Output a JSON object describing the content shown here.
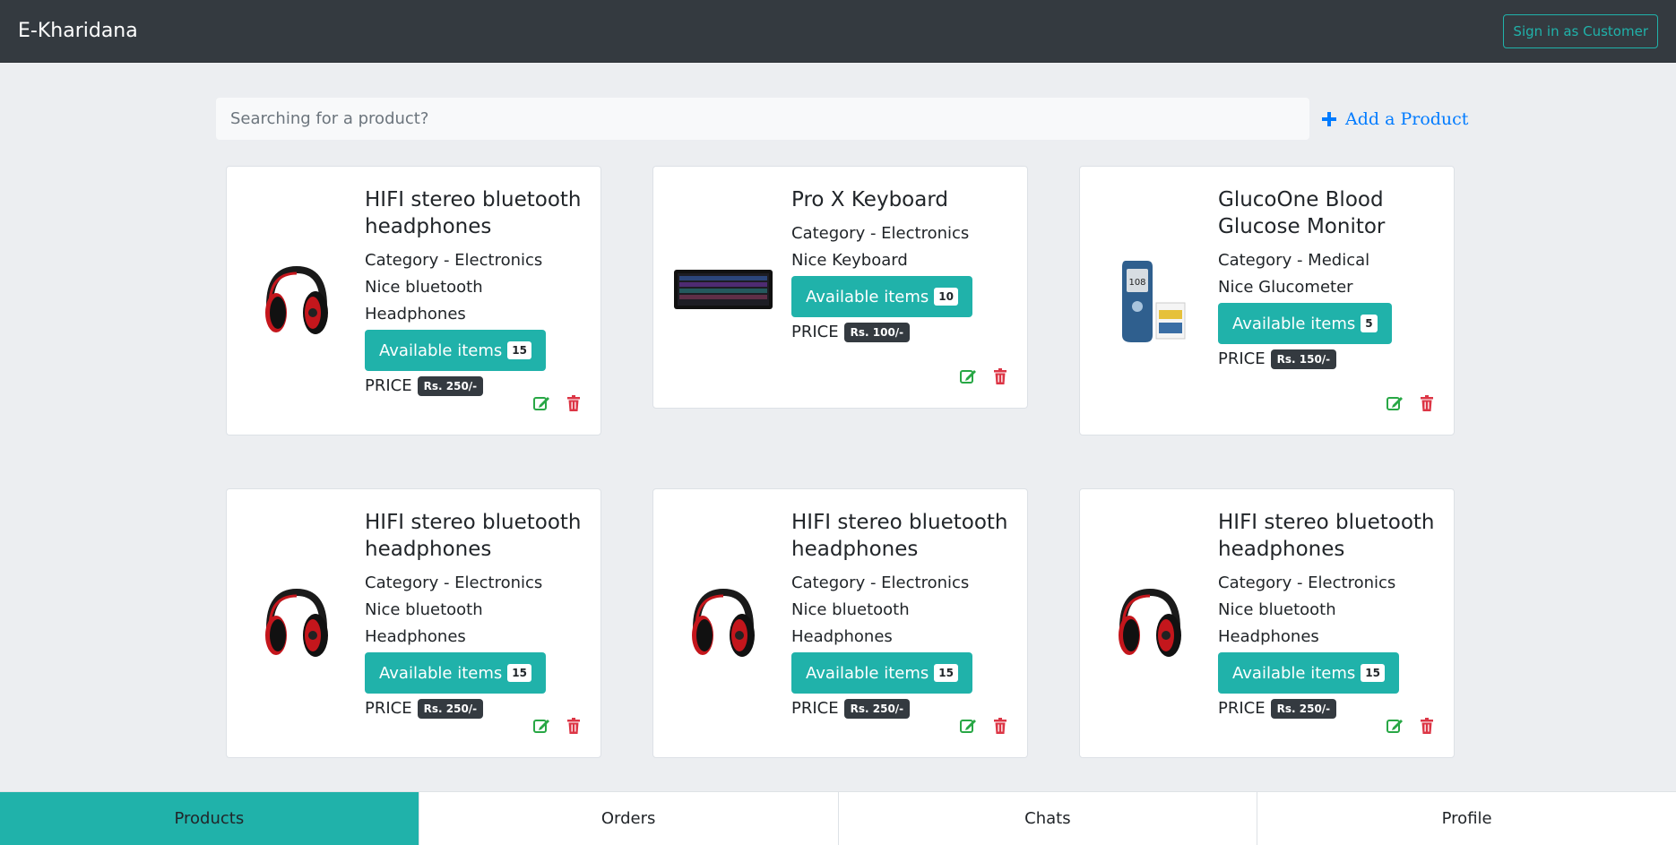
{
  "navbar": {
    "brand": "E-Kharidana",
    "signin_label": "Sign in as Customer"
  },
  "search": {
    "placeholder": "Searching for a product?",
    "add_product_label": "Add a Product"
  },
  "colors": {
    "accent": "#20b2aa",
    "navbar_bg": "#343a40",
    "edit_icon": "#28a745",
    "delete_icon": "#dc3545",
    "link": "#007bff"
  },
  "products": [
    {
      "title": "HIFI stereo bluetooth headphones",
      "category": "Category - Electronics",
      "description": "Nice bluetooth Headphones",
      "available_label": "Available items",
      "available_count": "15",
      "price_label": "PRICE",
      "price": "Rs. 250/-",
      "image": "headphones-image"
    },
    {
      "title": "Pro X Keyboard",
      "category": "Category - Electronics",
      "description": "Nice Keyboard",
      "available_label": "Available items",
      "available_count": "10",
      "price_label": "PRICE",
      "price": "Rs. 100/-",
      "image": "keyboard-image"
    },
    {
      "title": "GlucoOne Blood Glucose Monitor",
      "category": "Category - Medical",
      "description": "Nice Glucometer",
      "available_label": "Available items",
      "available_count": "5",
      "price_label": "PRICE",
      "price": "Rs. 150/-",
      "image": "glucometer-image"
    },
    {
      "title": "HIFI stereo bluetooth headphones",
      "category": "Category - Electronics",
      "description": "Nice bluetooth Headphones",
      "available_label": "Available items",
      "available_count": "15",
      "price_label": "PRICE",
      "price": "Rs. 250/-",
      "image": "headphones-image"
    },
    {
      "title": "HIFI stereo bluetooth headphones",
      "category": "Category - Electronics",
      "description": "Nice bluetooth Headphones",
      "available_label": "Available items",
      "available_count": "15",
      "price_label": "PRICE",
      "price": "Rs. 250/-",
      "image": "headphones-image"
    },
    {
      "title": "HIFI stereo bluetooth headphones",
      "category": "Category - Electronics",
      "description": "Nice bluetooth Headphones",
      "available_label": "Available items",
      "available_count": "15",
      "price_label": "PRICE",
      "price": "Rs. 250/-",
      "image": "headphones-image"
    }
  ],
  "bottom_nav": {
    "tabs": [
      {
        "label": "Products",
        "active": true
      },
      {
        "label": "Orders",
        "active": false
      },
      {
        "label": "Chats",
        "active": false
      },
      {
        "label": "Profile",
        "active": false
      }
    ]
  }
}
